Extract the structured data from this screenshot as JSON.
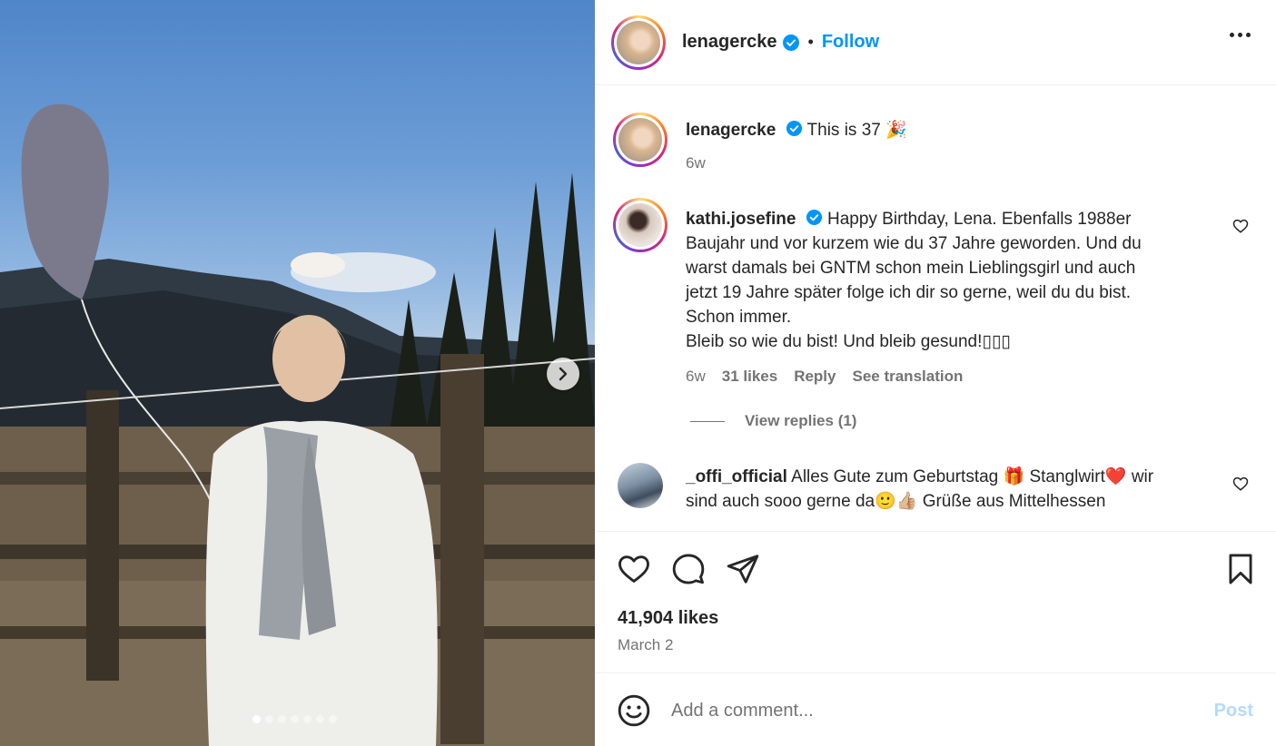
{
  "post": {
    "author": "lenagercke",
    "follow_label": "Follow",
    "bullet": "•",
    "likes": "41,904 likes",
    "date": "March 2",
    "image_slides": 7,
    "active_slide": 1
  },
  "caption": {
    "username": "lenagercke",
    "text": "This is 37 🎉",
    "time": "6w"
  },
  "comments": [
    {
      "username": "kathi.josefine",
      "lines": [
        "Happy Birthday, Lena. Ebenfalls 1988er",
        "Baujahr und vor kurzem wie du 37 Jahre geworden. Und du",
        "warst damals bei GNTM schon mein Lieblingsgirl und auch",
        "jetzt 19 Jahre später folge ich dir so gerne, weil du du bist.",
        "Schon immer.",
        "Bleib so wie du bist! Und bleib gesund!▯▯▯"
      ],
      "time": "6w",
      "likes": "31 likes",
      "reply_label": "Reply",
      "translate_label": "See translation",
      "view_replies": "View replies (1)"
    },
    {
      "username": "_offi_official",
      "lines": [
        "Alles Gute zum Geburtstag 🎁 Stanglwirt❤️ wir",
        "sind auch sooo gerne da🙂👍🏼 Grüße aus Mittelhessen"
      ]
    }
  ],
  "composer": {
    "placeholder": "Add a comment...",
    "post_label": "Post"
  },
  "colors": {
    "accent": "#0095f6",
    "text": "#262626",
    "muted": "#737373",
    "post_disabled": "#b3dbff"
  }
}
